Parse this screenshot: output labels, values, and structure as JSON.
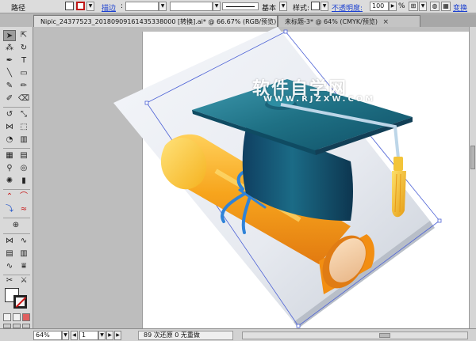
{
  "control_bar": {
    "object_type": "路径",
    "stroke_label": "描边",
    "stroke_width": ":",
    "brush_name": "基本",
    "style_label": "样式:",
    "opacity_label": "不透明度:",
    "opacity_value": "100",
    "opacity_unit": "%",
    "transform_label": "变换"
  },
  "tabs": [
    {
      "label": "Nipic_24377523_20180909161435338000 [转换].ai* @ 66.67% (RGB/预览)"
    },
    {
      "label": "未标题-3* @ 64% (CMYK/预览)"
    }
  ],
  "watermark": {
    "main": "软件自学网",
    "sub": "WWW.RJZXW.COM"
  },
  "status_bar": {
    "zoom": "64%",
    "page": "1",
    "message": "89 次还原 0 无重做"
  },
  "icons": [
    "selection-tool-icon",
    "direct-selection-icon",
    "pen-tool-icon",
    "type-tool-icon",
    "close-icon"
  ],
  "colors": {
    "cap_teal": "#1e6f86",
    "scroll_orange": "#f39a10",
    "ribbon_blue": "#2f83d8",
    "tassel_gold": "#f2b12a",
    "stroke_red": "#c01818"
  }
}
